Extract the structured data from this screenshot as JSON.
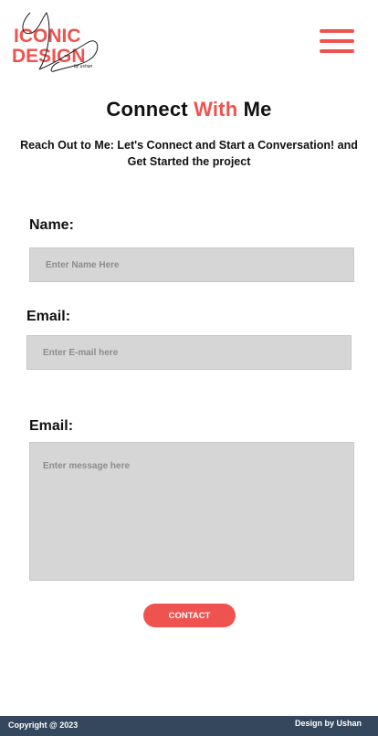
{
  "brand": {
    "logo_line1": "ICONIC",
    "logo_line2": "DESIGN",
    "logo_tagline": "by ushan",
    "accent_color": "#ef5350",
    "icon": "signature-logo"
  },
  "header": {
    "menu_icon": "hamburger-menu-icon"
  },
  "hero": {
    "title_part1": "Connect",
    "title_accent": "With",
    "title_part2": "Me",
    "subtitle": "Reach Out to Me: Let's Connect and Start a Conversation! and Get Started the project"
  },
  "form": {
    "name_label": "Name:",
    "name_placeholder": "Enter Name Here",
    "email_label": "Email:",
    "email_placeholder": "Enter E-mail here",
    "message_label": "Email:",
    "message_placeholder": "Enter message here",
    "submit_label": "CONTACT"
  },
  "footer": {
    "copyright": "Copyright @ 2023",
    "credit": "Design by Ushan",
    "background_color": "#34475d"
  }
}
